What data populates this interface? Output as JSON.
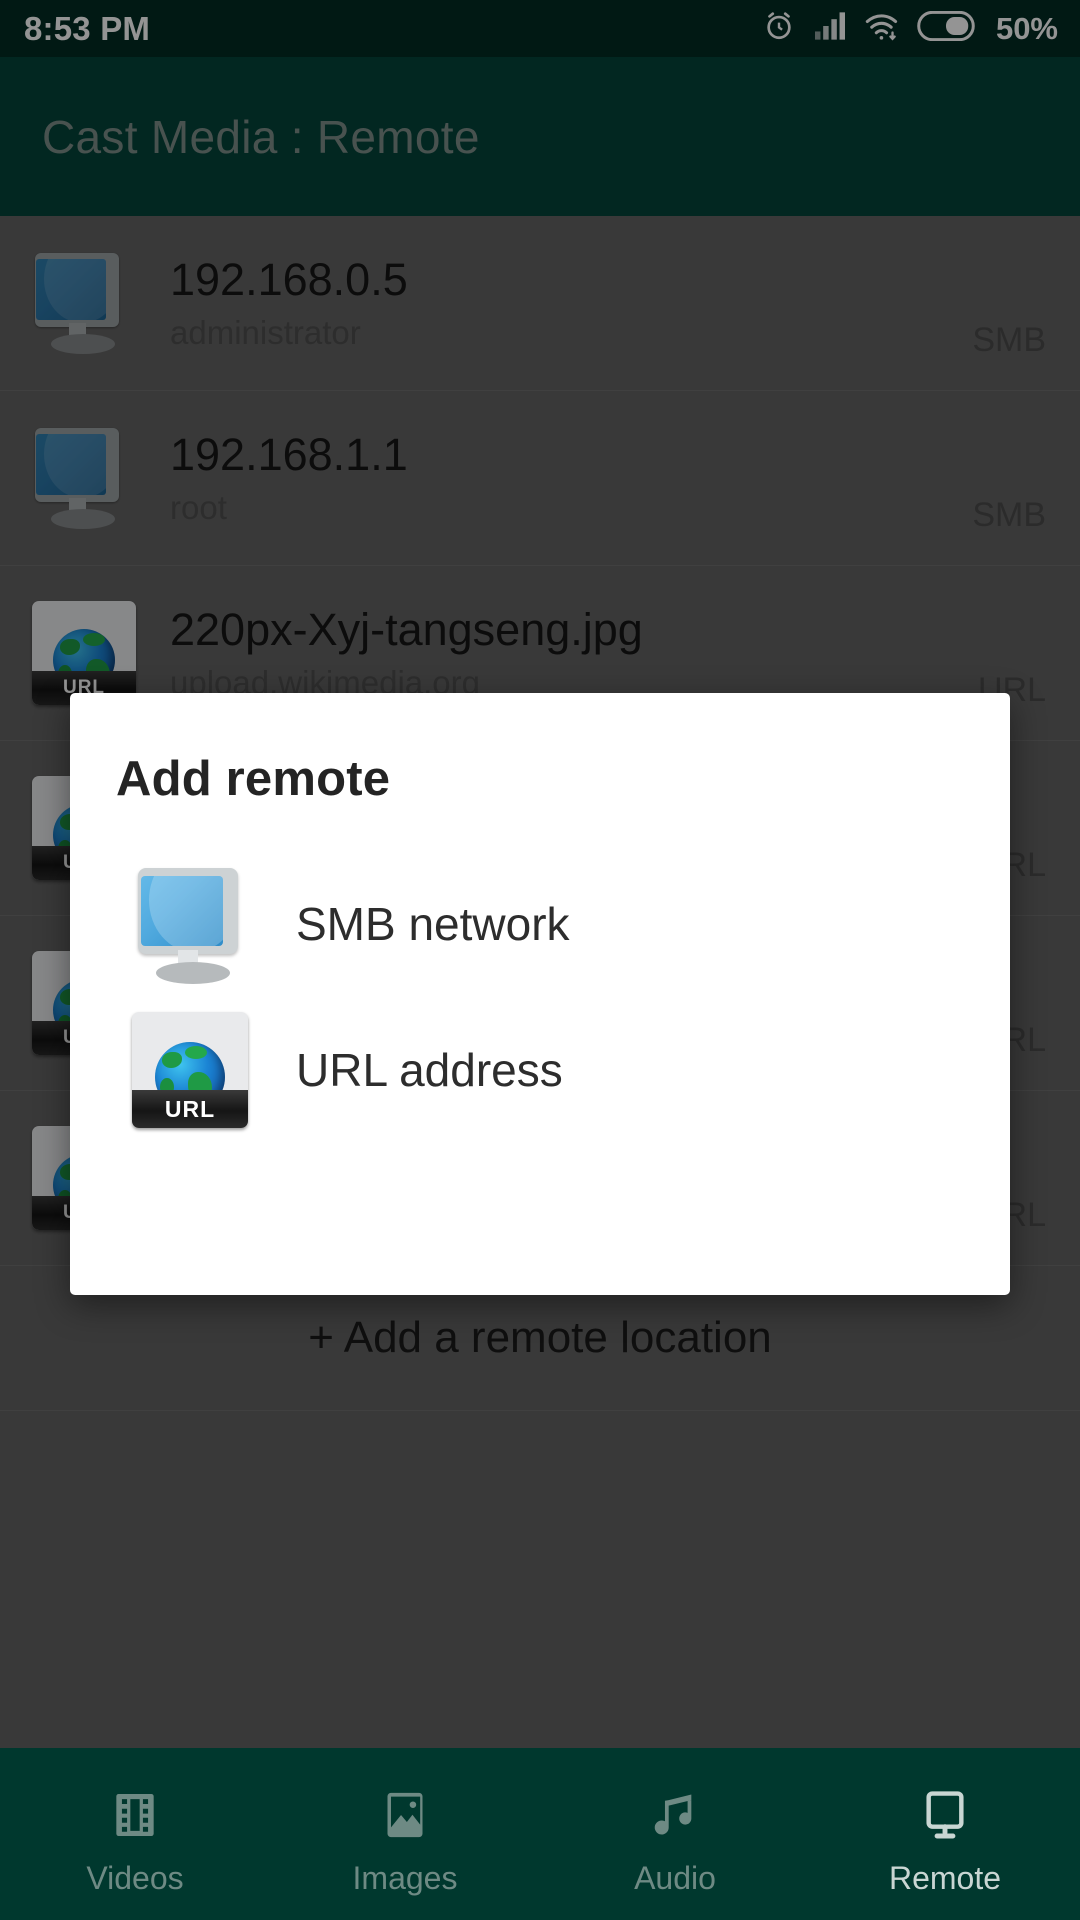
{
  "statusbar": {
    "time": "8:53 PM",
    "battery_percent": "50%",
    "icons": [
      "alarm-icon",
      "signal-icon",
      "wifi-icon",
      "battery-icon"
    ]
  },
  "appbar": {
    "title": "Cast Media : Remote"
  },
  "list": {
    "rows": [
      {
        "icon": "monitor-icon",
        "title": "192.168.0.5",
        "subtitle": "administrator",
        "badge": "SMB"
      },
      {
        "icon": "monitor-icon",
        "title": "192.168.1.1",
        "subtitle": "root",
        "badge": "SMB"
      },
      {
        "icon": "url-icon",
        "title": "220px-Xyj-tangseng.jpg",
        "subtitle": "upload.wikimedia.org",
        "badge": "URL"
      },
      {
        "icon": "url-icon",
        "title": "",
        "subtitle": "",
        "badge": "URL"
      },
      {
        "icon": "url-icon",
        "title": "",
        "subtitle": "",
        "badge": "URL"
      },
      {
        "icon": "url-icon",
        "title": "",
        "subtitle": "",
        "badge": "URL"
      }
    ],
    "add_label": "+ Add a remote location"
  },
  "dialog": {
    "title": "Add remote",
    "options": [
      {
        "icon": "monitor-icon",
        "label": "SMB network"
      },
      {
        "icon": "url-icon",
        "label": "URL address"
      }
    ]
  },
  "bottomnav": {
    "items": [
      {
        "icon": "film-icon",
        "label": "Videos",
        "active": false
      },
      {
        "icon": "image-icon",
        "label": "Images",
        "active": false
      },
      {
        "icon": "music-icon",
        "label": "Audio",
        "active": false
      },
      {
        "icon": "monitor-icon",
        "label": "Remote",
        "active": true
      }
    ]
  },
  "colors": {
    "statusbar_bg": "#032c23",
    "appbar_bg": "#04443a",
    "navbar_bg": "#00382e",
    "dialog_bg": "#ffffff",
    "scrim": "rgba(0,0,0,0.42)",
    "url_badge_text": "#4a4a4a"
  },
  "icon_glyphs": {
    "url_badge_text": "URL"
  }
}
